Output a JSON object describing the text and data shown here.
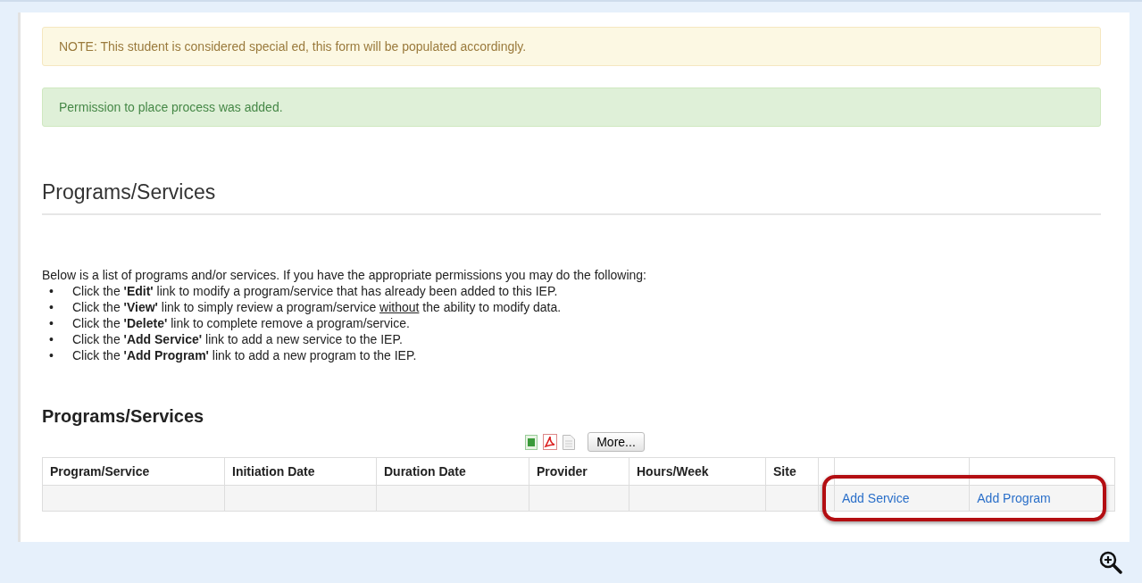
{
  "alerts": [
    {
      "kind": "warning",
      "text": "NOTE: This student is considered special ed, this form will be populated accordingly."
    },
    {
      "kind": "success",
      "text": "Permission to place process was added."
    }
  ],
  "section_title": "Programs/Services",
  "intro": "Below is a list of programs and/or services. If you have the appropriate permissions you may do the following:",
  "instructions": [
    {
      "bullet": "•",
      "text": "Click the **'Edit'** link to modify a program/service that has already been added to this IEP."
    },
    {
      "bullet": "•",
      "text": "Click the **'View'** link to simply review a program/service ",
      "underlined": "without",
      "text_after": " the ability to modify data."
    },
    {
      "bullet": "•",
      "text": "Click the **'Delete'** link to complete remove a program/service."
    },
    {
      "bullet": "•",
      "text": "Click the **'Add Service'** link to add a new service to the IEP."
    },
    {
      "bullet": "•",
      "text": "Click the **'Add Program'** link to add a new program to the IEP."
    }
  ],
  "table_title": "Programs/Services",
  "toolbar": {
    "more_button": "More..."
  },
  "table": {
    "columns": [
      "Program/Service",
      "Initiation Date",
      "Duration Date",
      "Provider",
      "Hours/Week",
      "Site"
    ],
    "links": [
      "Add Service",
      "Add Program"
    ]
  }
}
